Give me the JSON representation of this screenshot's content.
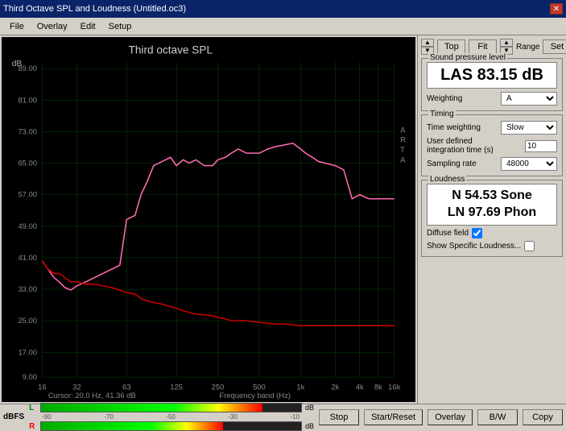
{
  "window": {
    "title": "Third Octave SPL and Loudness (Untitled.oc3)",
    "close_label": "✕"
  },
  "menu": {
    "items": [
      "File",
      "Overlay",
      "Edit",
      "Setup"
    ]
  },
  "nav_controls": {
    "top_label": "Top",
    "fit_label": "Fit",
    "range_label": "Range",
    "set_label": "Set"
  },
  "spl": {
    "group_title": "Sound pressure level",
    "value": "LAS 83.15 dB",
    "weighting_label": "Weighting",
    "weighting_value": "A"
  },
  "timing": {
    "group_title": "Timing",
    "time_weighting_label": "Time weighting",
    "time_weighting_value": "Slow",
    "integration_label": "User defined integration time (s)",
    "integration_value": "10",
    "sampling_label": "Sampling rate",
    "sampling_value": "48000"
  },
  "loudness": {
    "group_title": "Loudness",
    "value_line1": "N 54.53 Sone",
    "value_line2": "LN 97.69 Phon",
    "diffuse_label": "Diffuse field",
    "show_specific_label": "Show Specific Loudness..."
  },
  "chart": {
    "title": "Third octave SPL",
    "db_label": "dB",
    "y_labels": [
      "89.00",
      "81.00",
      "73.00",
      "65.00",
      "57.00",
      "49.00",
      "41.00",
      "33.00",
      "25.00",
      "17.00",
      "9.00"
    ],
    "x_labels": [
      "16",
      "32",
      "63",
      "125",
      "250",
      "500",
      "1k",
      "2k",
      "4k",
      "8k",
      "16k"
    ],
    "cursor_label": "Cursor: 20.0 Hz, 41.36 dB",
    "freq_band_label": "Frequency band (Hz)",
    "art_label": "A R T A"
  },
  "bottom": {
    "dbfs_label": "dBFS",
    "l_label": "L",
    "r_label": "R",
    "meter_ticks": [
      "-90",
      "-70",
      "-50",
      "-30",
      "-10"
    ],
    "stop_label": "Stop",
    "start_reset_label": "Start/Reset",
    "overlay_label": "Overlay",
    "bw_label": "B/W",
    "copy_label": "Copy"
  }
}
